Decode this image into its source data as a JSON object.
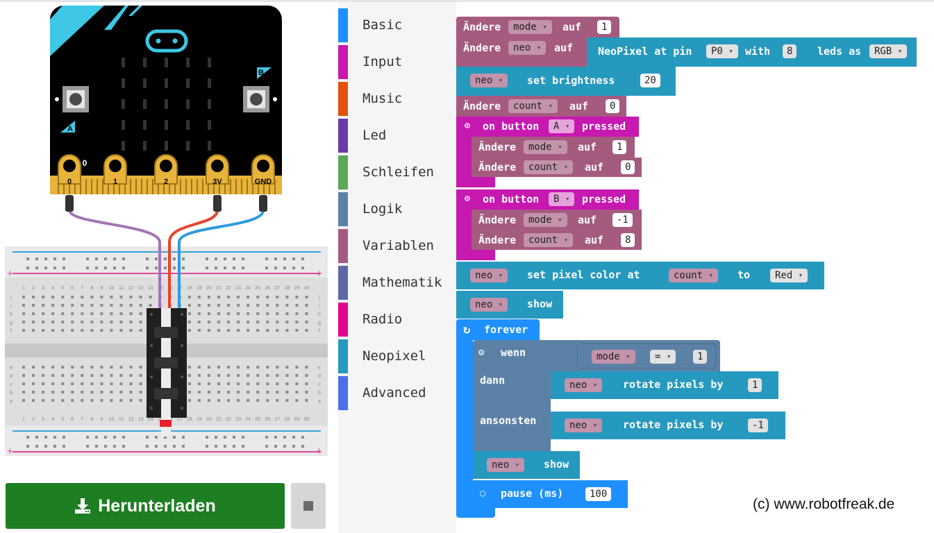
{
  "colors": {
    "basic": "#1e90ff",
    "input": "#c718b0",
    "music": "#e34f0d",
    "led": "#6b3aa9",
    "loops": "#5aa956",
    "logic": "#5c81a6",
    "variables": "#a55b80",
    "math": "#5c68a6",
    "radio": "#e3008c",
    "neopixel": "#2699bf",
    "advanced": "#4a6fe8",
    "download": "#1e7e22"
  },
  "simulator": {
    "pin_labels": [
      "0",
      "1",
      "2",
      "3V",
      "GND"
    ],
    "button_a": "A",
    "button_b": "B",
    "pin0_small": "0",
    "breadboard_columns": [
      "1",
      "2",
      "3",
      "4",
      "5",
      "6",
      "7",
      "8",
      "9",
      "10",
      "11",
      "12",
      "13",
      "14",
      "15",
      "16",
      "17",
      "18",
      "19",
      "20",
      "21",
      "22",
      "23",
      "24",
      "25",
      "26",
      "27",
      "28",
      "29",
      "30"
    ],
    "row_letters_top": [
      "j",
      "i",
      "h",
      "g",
      "f"
    ],
    "row_letters_bottom": [
      "e",
      "d",
      "c",
      "b",
      "a"
    ],
    "download_label": "Herunterladen",
    "download_icon": "download-icon",
    "stop_icon": "stop-icon"
  },
  "toolbox": {
    "categories": [
      {
        "label": "Basic"
      },
      {
        "label": "Input"
      },
      {
        "label": "Music"
      },
      {
        "label": "Led"
      },
      {
        "label": "Schleifen"
      },
      {
        "label": "Logik"
      },
      {
        "label": "Variablen"
      },
      {
        "label": "Mathematik"
      },
      {
        "label": "Radio"
      },
      {
        "label": "Neopixel"
      },
      {
        "label": "Advanced"
      }
    ]
  },
  "workspace": {
    "set_word": "Ändere",
    "to_word": "auf",
    "b1": {
      "var": "mode",
      "value": "1"
    },
    "b2": {
      "var": "neo",
      "np_text": "NeoPixel at pin",
      "pin": "P0",
      "with": "with",
      "count": "8",
      "leds_as": "leds as",
      "mode": "RGB"
    },
    "b3": {
      "var": "neo",
      "text": "set brightness",
      "value": "20"
    },
    "b4": {
      "var": "count",
      "value": "0"
    },
    "b5": {
      "text_on": "on button",
      "button": "A",
      "text_pressed": "pressed",
      "set1_var": "mode",
      "set1_value": "1",
      "set2_var": "count",
      "set2_value": "0"
    },
    "b6": {
      "text_on": "on button",
      "button": "B",
      "text_pressed": "pressed",
      "set1_var": "mode",
      "set1_value": "-1",
      "set2_var": "count",
      "set2_value": "8"
    },
    "b7": {
      "var": "neo",
      "text": "set pixel color at",
      "index_var": "count",
      "to": "to",
      "color": "Red"
    },
    "b8": {
      "var": "neo",
      "text": "show"
    },
    "forever": {
      "label": "forever",
      "if_label": "wenn",
      "then_label": "dann",
      "else_label": "ansonsten",
      "cond_var": "mode",
      "cond_op": "=",
      "cond_value": "1",
      "then_var": "neo",
      "then_text": "rotate pixels by",
      "then_value": "1",
      "else_var": "neo",
      "else_text": "rotate pixels by",
      "else_value": "-1",
      "show_var": "neo",
      "show_text": "show",
      "pause_text": "pause (ms)",
      "pause_value": "100"
    }
  },
  "copyright": "(c) www.robotfreak.de"
}
